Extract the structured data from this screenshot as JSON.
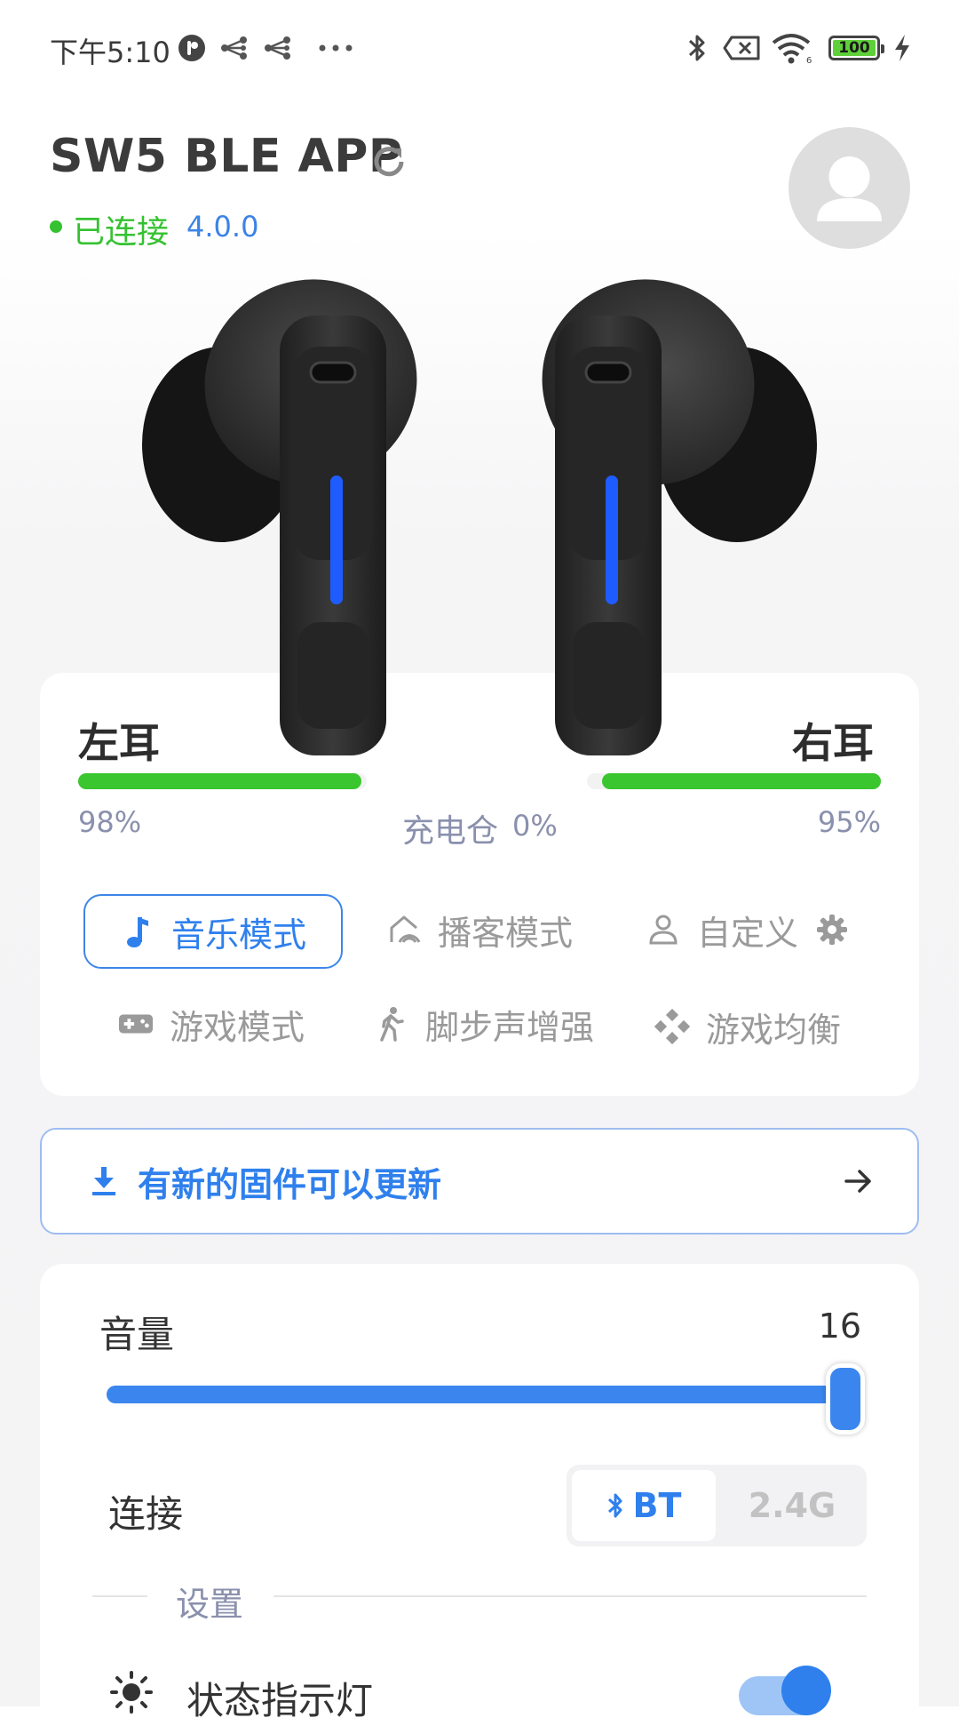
{
  "status_bar": {
    "time": "下午5:10",
    "battery": "100"
  },
  "header": {
    "app_title": "SW5 BLE APP",
    "connection_status": "已连接",
    "firmware_version": "4.0.0"
  },
  "earbuds": {
    "left_label": "左耳",
    "right_label": "右耳",
    "left_battery_text": "98%",
    "right_battery_text": "95%",
    "left_battery_level": 0.98,
    "right_battery_level": 0.95,
    "case_label": "充电仓",
    "case_battery_text": "0%"
  },
  "modes": [
    {
      "label": "音乐模式",
      "icon": "music-note-icon",
      "active": true
    },
    {
      "label": "播客模式",
      "icon": "podcast-icon",
      "active": false
    },
    {
      "label": "自定义",
      "icon": "person-icon",
      "active": false
    },
    {
      "label": "游戏模式",
      "icon": "gamepad-icon",
      "active": false
    },
    {
      "label": "脚步声增强",
      "icon": "walking-icon",
      "active": false
    },
    {
      "label": "游戏均衡",
      "icon": "dpad-icon",
      "active": false
    }
  ],
  "update_banner": {
    "text": "有新的固件可以更新",
    "icon": "download-icon",
    "arrow_icon": "arrow-right-icon"
  },
  "volume": {
    "label": "音量",
    "value": "16",
    "level": 1.0
  },
  "connection": {
    "label": "连接",
    "options": [
      "BT",
      "2.4G"
    ],
    "selected": "BT"
  },
  "settings": {
    "section_label": "设置",
    "status_light_label": "状态指示灯",
    "status_light_on": true
  },
  "colors": {
    "accent": "#2f80ed",
    "battery_green": "#3ac62e",
    "connected_green": "#35c231",
    "version_blue": "#3c83e6"
  }
}
